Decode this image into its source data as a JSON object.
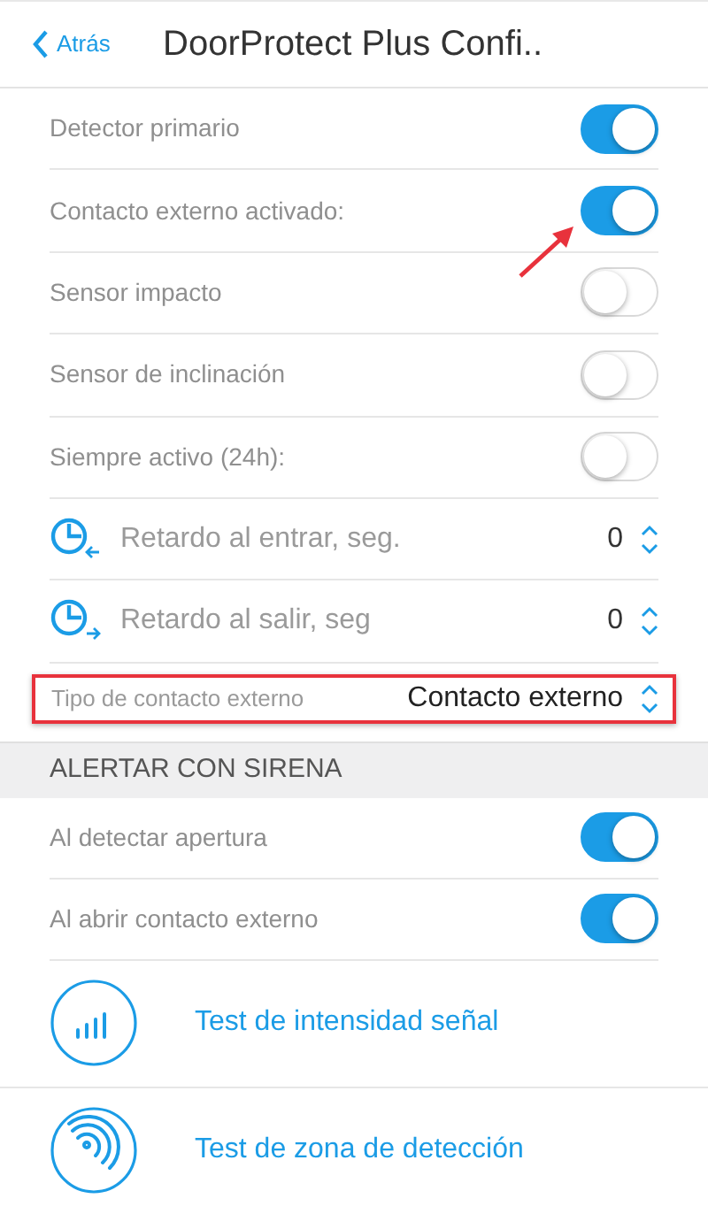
{
  "header": {
    "back": "Atrás",
    "title": "DoorProtect Plus Confi.."
  },
  "settings": [
    {
      "kind": "toggle",
      "label": "Detector primario",
      "on": true,
      "annotated": false
    },
    {
      "kind": "toggle",
      "label": "Contacto externo activado:",
      "on": true,
      "annotated": true
    },
    {
      "kind": "toggle",
      "label": "Sensor impacto",
      "on": false,
      "annotated": false
    },
    {
      "kind": "toggle",
      "label": "Sensor de inclinación",
      "on": false,
      "annotated": false
    },
    {
      "kind": "toggle",
      "label": "Siempre activo (24h):",
      "on": false,
      "annotated": false
    },
    {
      "kind": "stepper",
      "label": "Retardo al entrar, seg.",
      "value": "0"
    },
    {
      "kind": "stepper",
      "label": "Retardo al salir, seg",
      "value": "0"
    },
    {
      "kind": "select",
      "label": "Tipo de contacto externo",
      "value": "Contacto externo",
      "highlighted": true
    }
  ],
  "siren": {
    "title": "ALERTAR CON SIRENA",
    "items": [
      {
        "label": "Al detectar apertura",
        "on": true
      },
      {
        "label": "Al abrir contacto externo",
        "on": true
      }
    ]
  },
  "tests": [
    {
      "label": "Test de intensidad señal"
    },
    {
      "label": "Test de zona de detección"
    }
  ]
}
